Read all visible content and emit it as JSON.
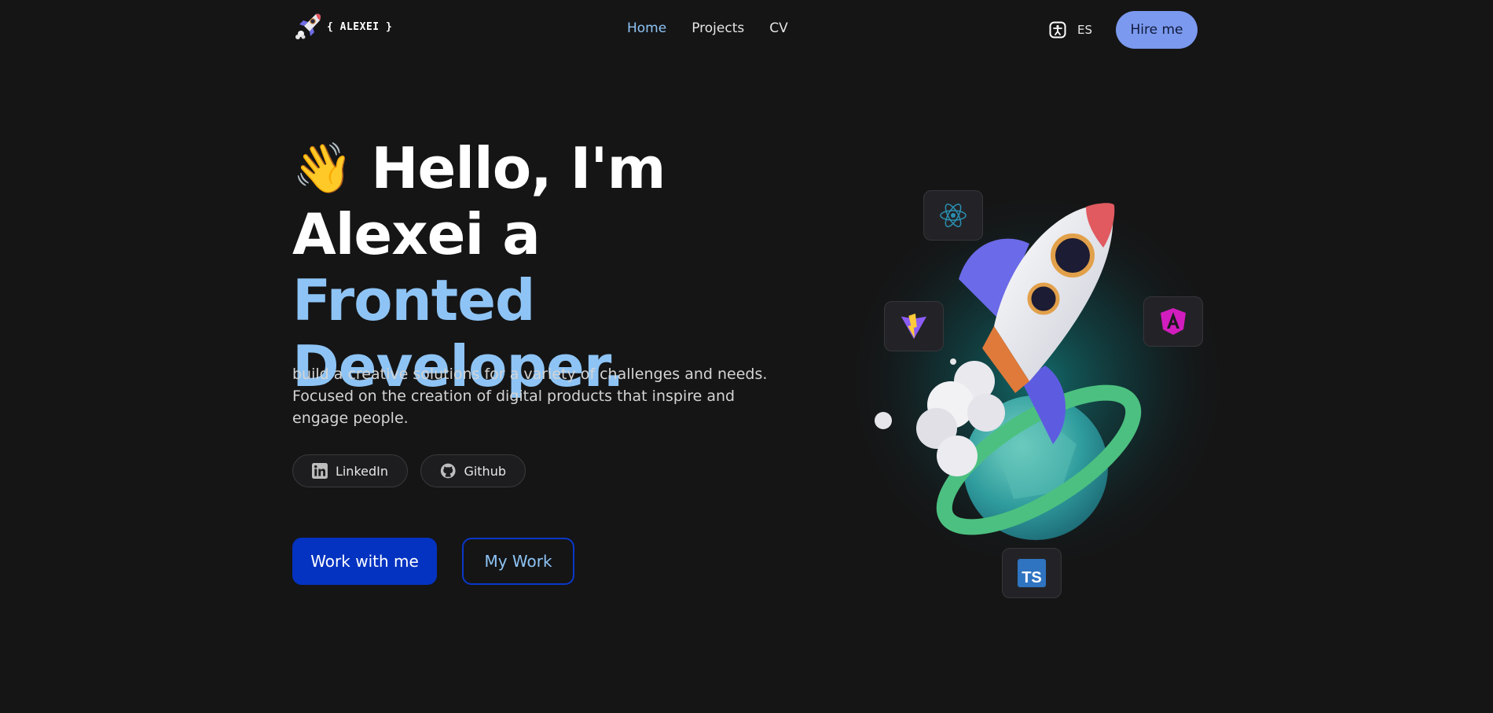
{
  "brand": {
    "logo_icon": "rocket-icon",
    "name": "{ ALEXEI }"
  },
  "nav": {
    "links": [
      {
        "label": "Home",
        "active": true
      },
      {
        "label": "Projects",
        "active": false
      },
      {
        "label": "CV",
        "active": false
      }
    ],
    "accessibility_icon": "accessibility-icon",
    "language": "ES",
    "hire_label": "Hire me"
  },
  "hero": {
    "wave_emoji": "👋",
    "title_part1": "Hello, I'm",
    "title_part2": "Alexei a",
    "title_accent": "Fronted Developer.",
    "description": "build a creative solutions for a variety of challenges and needs. Focused on the creation of digital products that inspire and engage people.",
    "social": [
      {
        "label": "LinkedIn",
        "icon": "linkedin-icon"
      },
      {
        "label": "Github",
        "icon": "github-icon"
      }
    ],
    "cta_primary": "Work with me",
    "cta_secondary": "My Work"
  },
  "illustration": {
    "image": "rocket-planet-illustration",
    "tech_icons": [
      "react-icon",
      "vite-icon",
      "angular-icon",
      "typescript-icon"
    ],
    "ts_badge_text": "TS"
  },
  "colors": {
    "background": "#151516",
    "accent": "#8ec4f5",
    "primary_button": "#0433c1",
    "hire_button": "#7b99ee"
  }
}
